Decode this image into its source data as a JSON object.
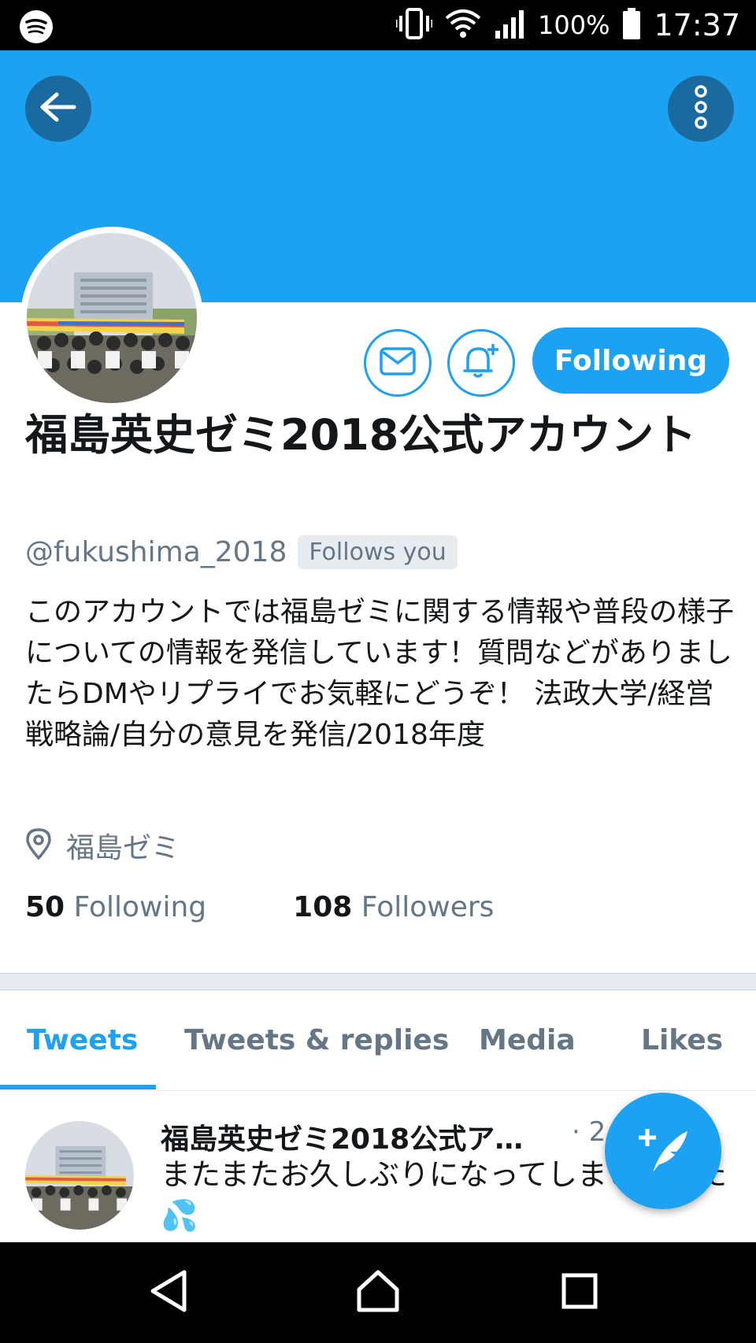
{
  "status_bar": {
    "battery_percent": "100%",
    "time": "17:37",
    "icons": [
      "spotify-icon",
      "vibrate-icon",
      "wifi-icon",
      "signal-icon",
      "battery-icon"
    ]
  },
  "header": {
    "back_icon": "arrow-left-icon",
    "more_icon": "more-vertical-icon",
    "banner_color": "#1da1f2"
  },
  "profile": {
    "display_name": "福島英史ゼミ2018公式アカウント",
    "handle": "@fukushima_2018",
    "follows_you": "Follows you",
    "bio": "このアカウントでは福島ゼミに関する情報や普段の様子についての情報を発信しています！質問などがありましたらDMやリプライでお気軽にどうぞ！ 法政大学/経営戦略論/自分の意見を発信/2018年度",
    "location": "福島ゼミ",
    "following_count": "50",
    "following_label": "Following",
    "followers_count": "108",
    "followers_label": "Followers"
  },
  "actions": {
    "following_button": "Following",
    "dm_icon": "mail-icon",
    "notify_icon": "bell-plus-icon"
  },
  "tabs": [
    {
      "label": "Tweets",
      "active": true
    },
    {
      "label": "Tweets & replies",
      "active": false
    },
    {
      "label": "Media",
      "active": false
    },
    {
      "label": "Likes",
      "active": false
    }
  ],
  "tweet": {
    "author": "福島英史ゼミ2018公式ア…",
    "time": "· 2",
    "text": "またまたお久しぶりになってしまいました💦"
  },
  "colors": {
    "accent": "#1da1f2",
    "text": "#14171a",
    "secondary": "#657786"
  }
}
